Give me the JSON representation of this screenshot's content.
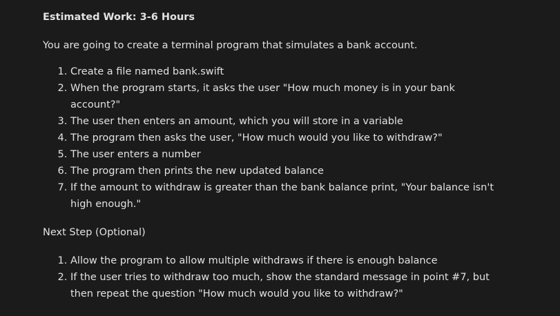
{
  "heading": "Estimated Work: 3-6 Hours",
  "intro": "You are going to create a terminal program that simulates a bank account.",
  "steps": [
    "Create a file named bank.swift",
    "When the program starts, it asks the user \"How much money is in your bank account?\"",
    "The user then enters an amount, which you will store in a variable",
    "The program then asks the user, \"How much would you like to withdraw?\"",
    "The user enters a number",
    "The program then prints the new updated balance",
    "If the amount to withdraw is greater than the bank balance print, \"Your balance isn't high enough.\""
  ],
  "next_step_title": "Next Step (Optional)",
  "next_steps": [
    "Allow the program to allow multiple withdraws if there is enough balance",
    "If the user tries to withdraw too much, show the standard message in point #7, but then repeat the question \"How much would you like to withdraw?\""
  ]
}
